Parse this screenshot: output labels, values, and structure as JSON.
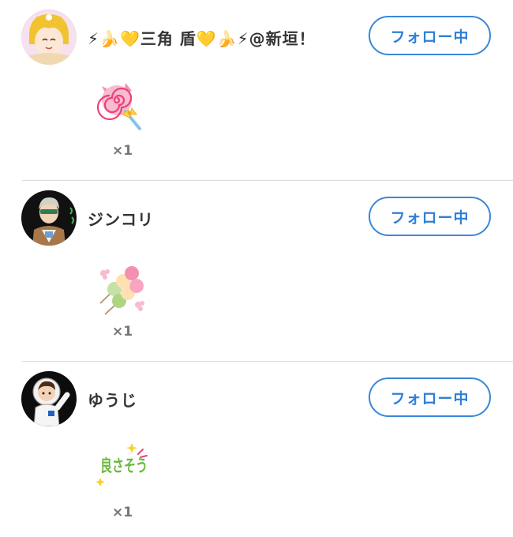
{
  "entries": [
    {
      "user_name": "⚡🍌💛三角 盾💛🍌⚡@新垣！",
      "follow_label": "フォロー中",
      "stamp_icon": "lollipop-icon",
      "count": "×1"
    },
    {
      "user_name": "ジンコリ",
      "follow_label": "フォロー中",
      "stamp_icon": "dango-icon",
      "count": "×1"
    },
    {
      "user_name": "ゆうじ",
      "follow_label": "フォロー中",
      "stamp_icon": "yosasou-stamp",
      "stamp_text": "良さそう",
      "count": "×1"
    }
  ],
  "colors": {
    "accent": "#3a87d8",
    "divider": "#dcdcdc",
    "text": "#333333"
  }
}
